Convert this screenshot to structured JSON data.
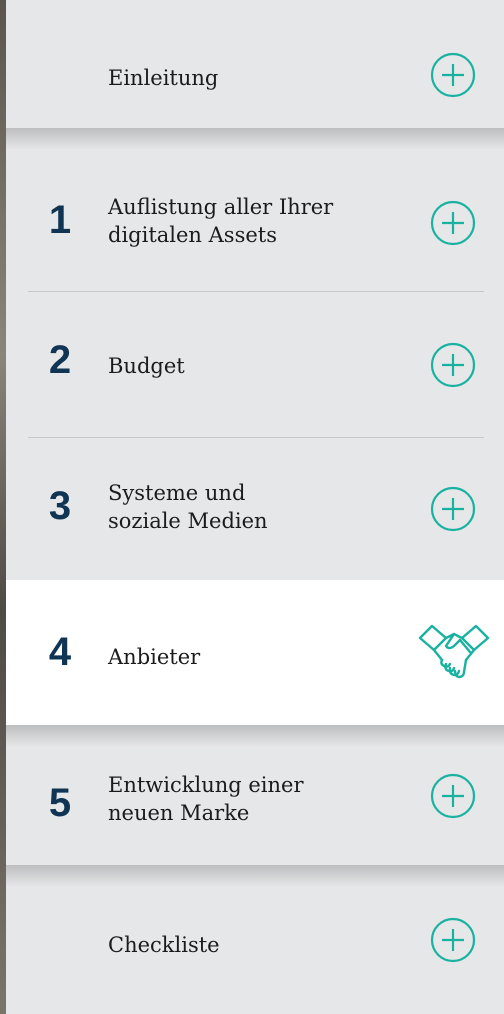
{
  "menu": {
    "items": [
      {
        "num": "",
        "label": "Einleitung",
        "icon": "plus-circle-icon"
      },
      {
        "num": "1",
        "label": "Auflistung aller Ihrer digitalen Assets",
        "icon": "plus-circle-icon"
      },
      {
        "num": "2",
        "label": "Budget",
        "icon": "plus-circle-icon"
      },
      {
        "num": "3",
        "label": "Systeme und soziale Medien",
        "icon": "plus-circle-icon"
      },
      {
        "num": "4",
        "label": "Anbieter",
        "icon": "handshake-icon",
        "active": true
      },
      {
        "num": "5",
        "label": "Entwicklung einer neuen Marke",
        "icon": "plus-circle-icon"
      },
      {
        "num": "",
        "label": "Checkliste",
        "icon": "plus-circle-icon"
      }
    ]
  },
  "colors": {
    "accent": "#19b2a1",
    "number": "#0f3454",
    "panel": "#e6e7e8",
    "active_panel": "#ffffff"
  }
}
